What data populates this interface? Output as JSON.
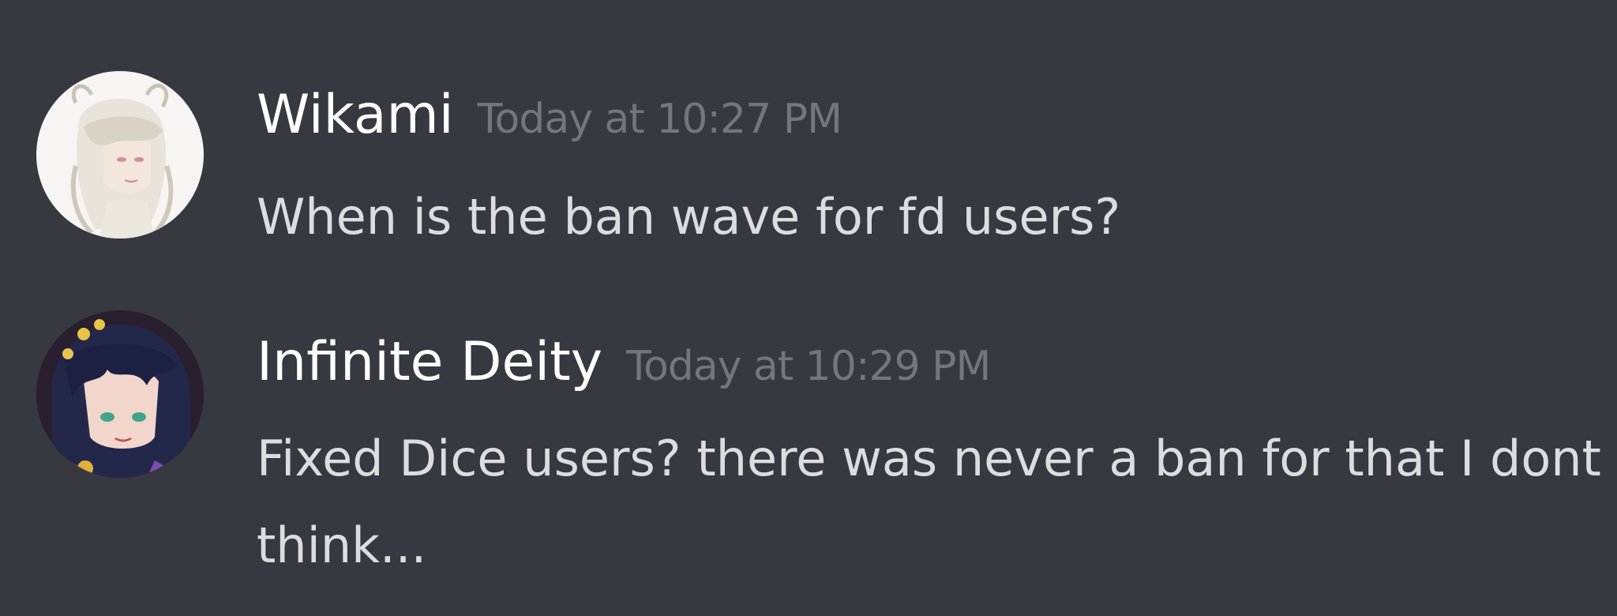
{
  "colors": {
    "background": "#36393f",
    "username": "#ffffff",
    "timestamp": "#72767d",
    "message_text": "#dcddde"
  },
  "messages": [
    {
      "author": "Wikami",
      "timestamp": "Today at 10:27 PM",
      "avatar_icon": "user-avatar-white-haired-anime-character",
      "lines": [
        "When is the ban wave for fd users?"
      ]
    },
    {
      "author": "Infinite Deity",
      "timestamp": "Today at 10:29 PM",
      "avatar_icon": "user-avatar-dark-haired-anime-character",
      "lines": [
        "Fixed Dice users? there was never a ban for that I dont",
        "think..."
      ]
    }
  ]
}
